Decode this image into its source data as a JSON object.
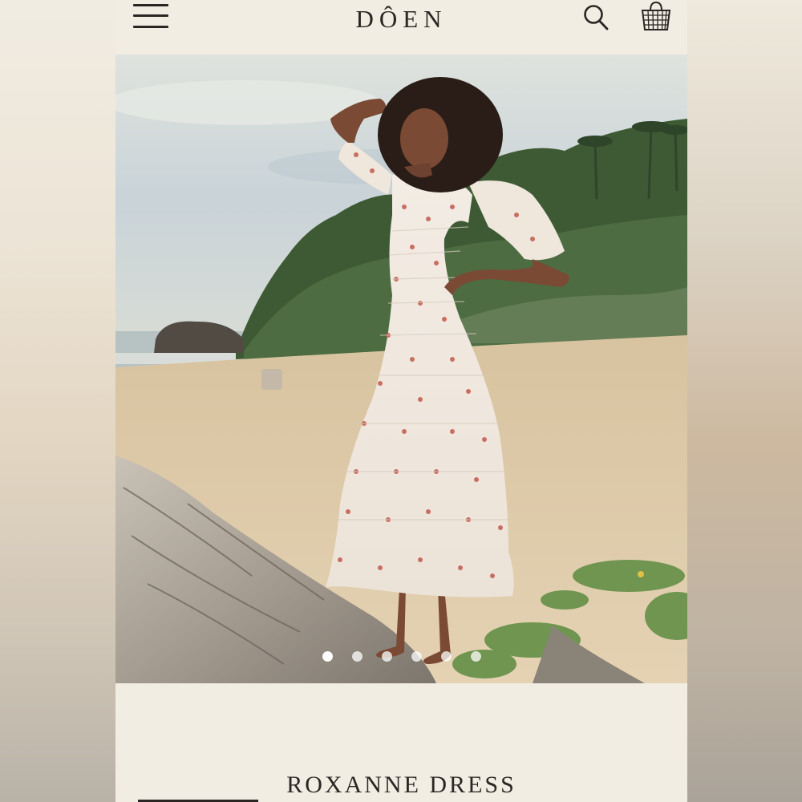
{
  "header": {
    "brand": "DÔEN",
    "menu_icon": "hamburger-menu-icon",
    "search_icon": "search-icon",
    "cart_icon": "basket-icon"
  },
  "hero": {
    "image_description": "",
    "carousel": {
      "total": 6,
      "active_index": 0
    }
  },
  "product": {
    "title": "ROXANNE DRESS"
  },
  "colors": {
    "background": "#f2ede3",
    "text": "#2b2623"
  }
}
